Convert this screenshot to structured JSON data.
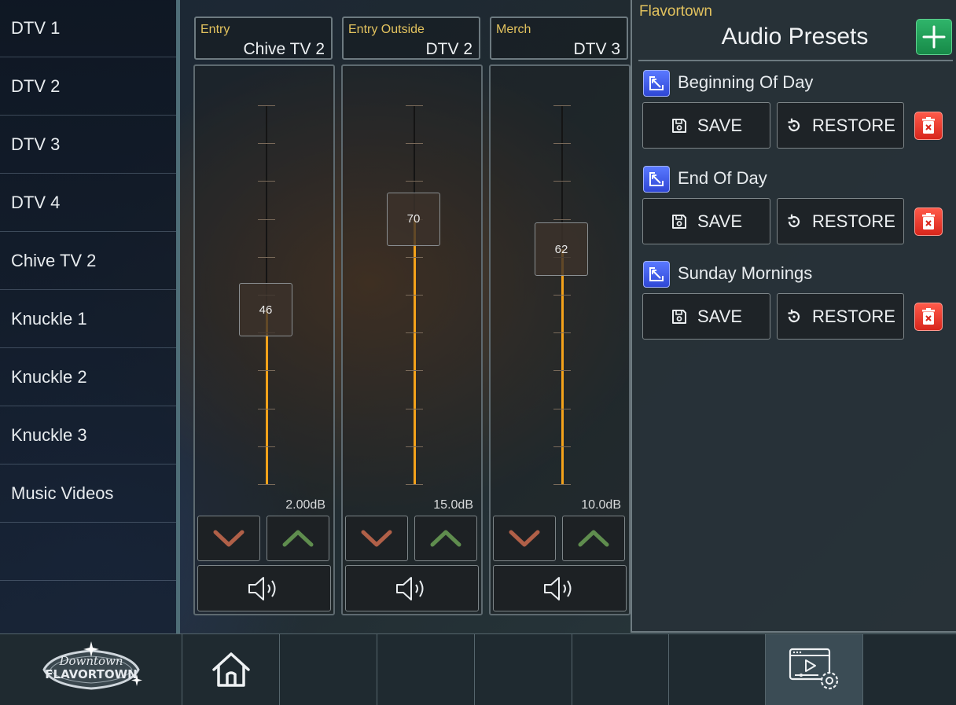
{
  "sidebar": {
    "items": [
      {
        "label": "DTV 1"
      },
      {
        "label": "DTV 2"
      },
      {
        "label": "DTV 3"
      },
      {
        "label": "DTV 4"
      },
      {
        "label": "Chive TV 2"
      },
      {
        "label": "Knuckle 1"
      },
      {
        "label": "Knuckle 2"
      },
      {
        "label": "Knuckle 3"
      },
      {
        "label": "Music Videos"
      }
    ]
  },
  "channels": [
    {
      "zone": "Entry",
      "source": "Chive TV 2",
      "level": 46,
      "db": "2.00dB"
    },
    {
      "zone": "Entry Outside",
      "source": "DTV 2",
      "level": 70,
      "db": "15.0dB"
    },
    {
      "zone": "Merch",
      "source": "DTV 3",
      "level": 62,
      "db": "10.0dB"
    }
  ],
  "presets_panel": {
    "zone": "Flavortown",
    "title": "Audio Presets",
    "save_label": "SAVE",
    "restore_label": "RESTORE",
    "items": [
      {
        "name": "Beginning Of Day"
      },
      {
        "name": "End Of Day"
      },
      {
        "name": "Sunday Mornings"
      }
    ]
  },
  "bottombar": {
    "logo": {
      "line1": "Downtown",
      "line2": "FLAVORTOWN"
    }
  },
  "colors": {
    "accent_gold": "#e2c25e",
    "fader_fill": "#f4a21a",
    "add_green": "#1fa259",
    "delete_red": "#e8342a",
    "edit_blue": "#3f5cf0"
  },
  "icons": [
    "chevron-down-icon",
    "chevron-up-icon",
    "speaker-icon",
    "plus-icon",
    "edit-icon",
    "save-disk-icon",
    "restore-icon",
    "trash-icon",
    "home-icon",
    "media-settings-icon"
  ]
}
